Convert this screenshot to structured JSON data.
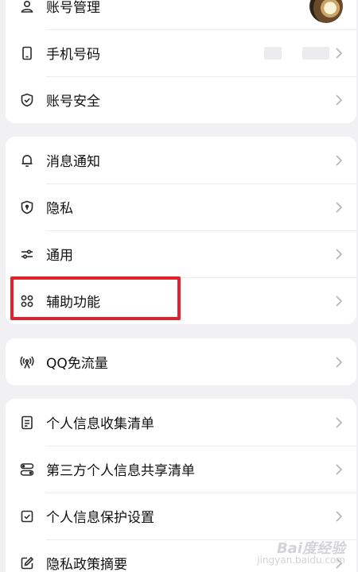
{
  "account_card": {
    "items": [
      {
        "label": "账号管理",
        "icon": "person-icon"
      },
      {
        "label": "手机号码",
        "icon": "phone-icon"
      },
      {
        "label": "账号安全",
        "icon": "shield-check-icon"
      }
    ]
  },
  "settings_card": {
    "items": [
      {
        "label": "消息通知",
        "icon": "bell-icon"
      },
      {
        "label": "隐私",
        "icon": "shield-keyhole-icon"
      },
      {
        "label": "通用",
        "icon": "sliders-icon"
      },
      {
        "label": "辅助功能",
        "icon": "command-icon"
      }
    ]
  },
  "data_card": {
    "items": [
      {
        "label": "QQ免流量",
        "icon": "signal-tower-icon"
      }
    ]
  },
  "privacy_card": {
    "items": [
      {
        "label": "个人信息收集清单",
        "icon": "document-icon"
      },
      {
        "label": "第三方个人信息共享清单",
        "icon": "share-list-icon"
      },
      {
        "label": "个人信息保护设置",
        "icon": "checkbox-icon"
      },
      {
        "label": "隐私政策摘要",
        "icon": "edit-icon"
      }
    ]
  },
  "watermark": {
    "brand": "Bai度经验",
    "site": "jingyan.baidu.com"
  },
  "colors": {
    "background": "#f1f1f3",
    "card": "#ffffff",
    "highlight": "#e2212b",
    "text": "#111111",
    "icon": "#2b2b2b",
    "chevron": "#b5b5ba"
  }
}
